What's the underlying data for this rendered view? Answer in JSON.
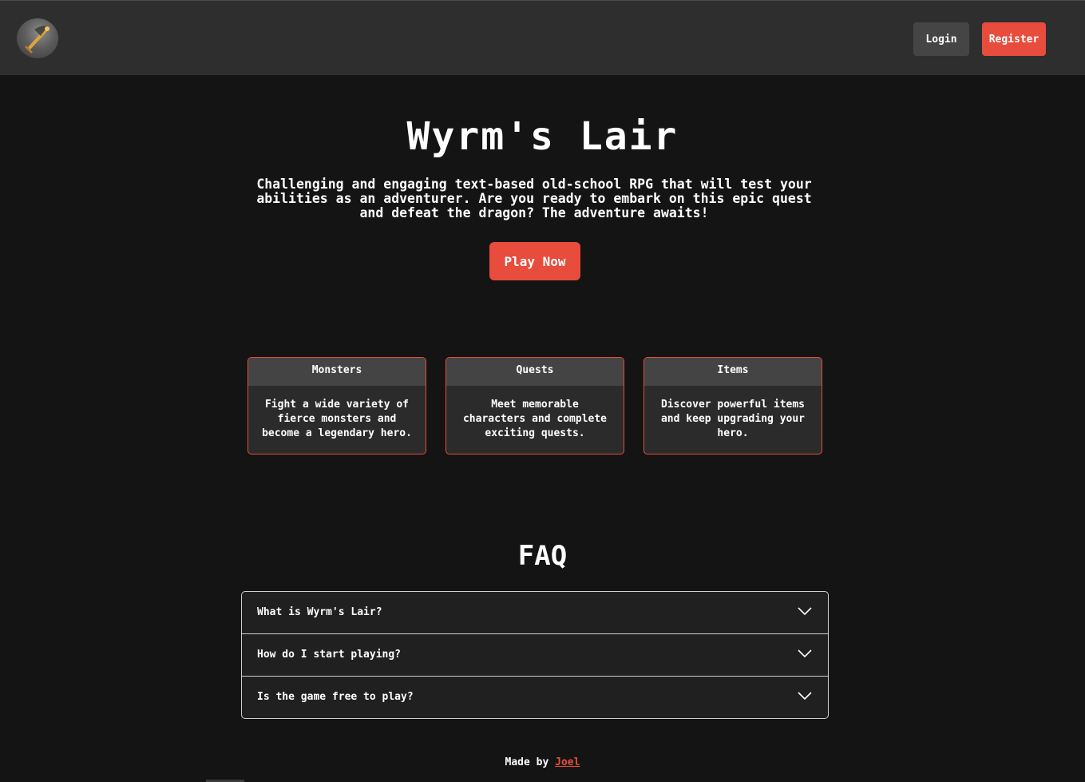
{
  "header": {
    "logo": "dragon-sword-logo",
    "login_label": "Login",
    "register_label": "Register"
  },
  "hero": {
    "title": "Wyrm's Lair",
    "description": "Challenging and engaging text-based old-school RPG that will test your abilities as an adventurer. Are you ready to embark on this epic quest and defeat the dragon? The adventure awaits!",
    "play_label": "Play Now"
  },
  "features": [
    {
      "title": "Monsters",
      "text": "Fight a wide variety of fierce monsters and become a legendary hero."
    },
    {
      "title": "Quests",
      "text": "Meet memorable characters and complete exciting quests."
    },
    {
      "title": "Items",
      "text": "Discover powerful items and keep upgrading your hero."
    }
  ],
  "faq": {
    "title": "FAQ",
    "items": [
      {
        "question": "What is Wyrm's Lair?"
      },
      {
        "question": "How do I start playing?"
      },
      {
        "question": "Is the game free to play?"
      }
    ]
  },
  "footer": {
    "made_by": "Made by",
    "author": "Joel"
  },
  "colors": {
    "accent": "#e74c3c",
    "background": "#141414",
    "header_bg": "#2e2e2e",
    "card_bg": "#2b2b2b"
  },
  "icons": {
    "faq_toggle": "chevron-down-icon"
  }
}
